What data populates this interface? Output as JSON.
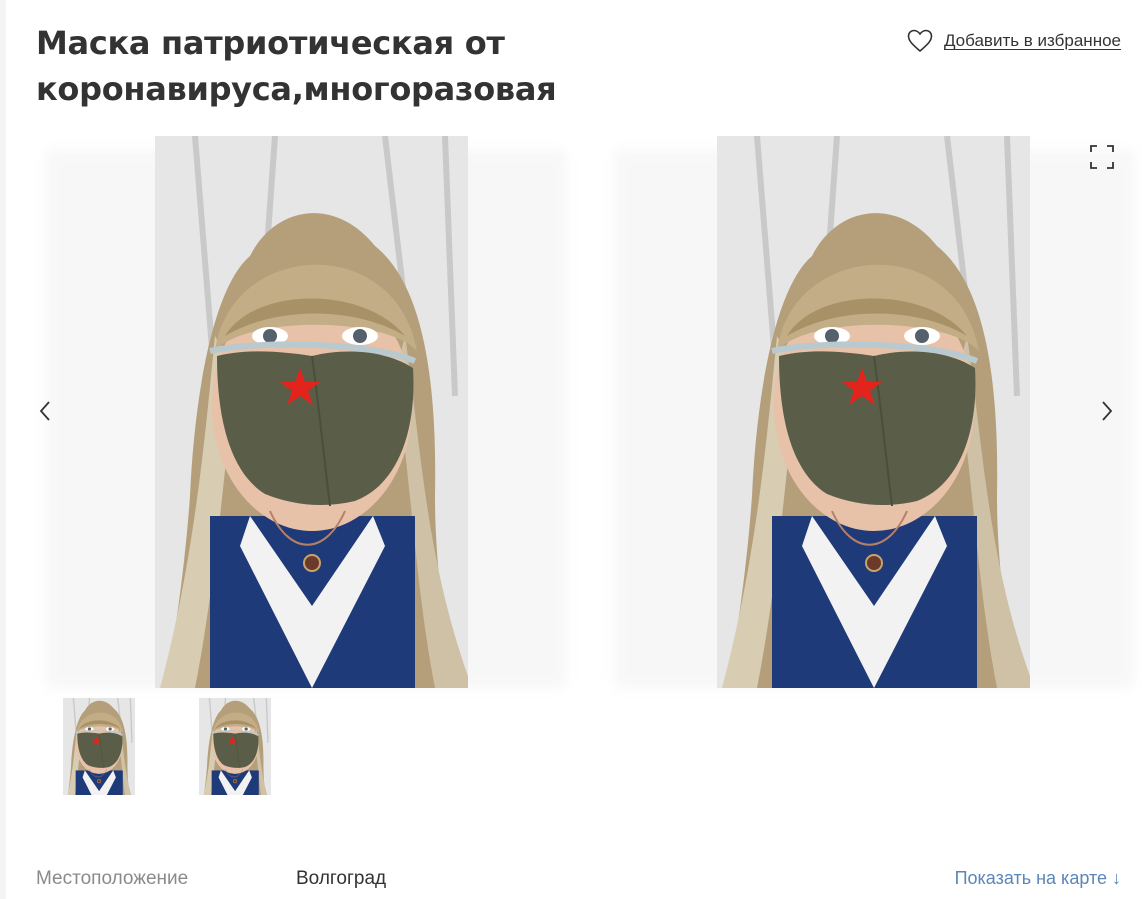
{
  "listing": {
    "title": "Маска патриотическая от коронавируса,многоразовая",
    "favorite_label": "Добавить в избранное"
  },
  "gallery": {
    "photo_count": 2,
    "active_index": 1
  },
  "location": {
    "label": "Местоположение",
    "value": "Волгоград",
    "map_link": "Показать на карте ↓"
  },
  "colors": {
    "text": "#333333",
    "muted": "#8a8a8a",
    "link": "#5a86b8",
    "mask": "#5a5e48",
    "star": "#e3241d",
    "shirt": "#1f3a78"
  },
  "icons": {
    "favorite": "heart-icon",
    "prev": "chevron-left-icon",
    "next": "chevron-right-icon",
    "fullscreen": "fullscreen-icon"
  }
}
